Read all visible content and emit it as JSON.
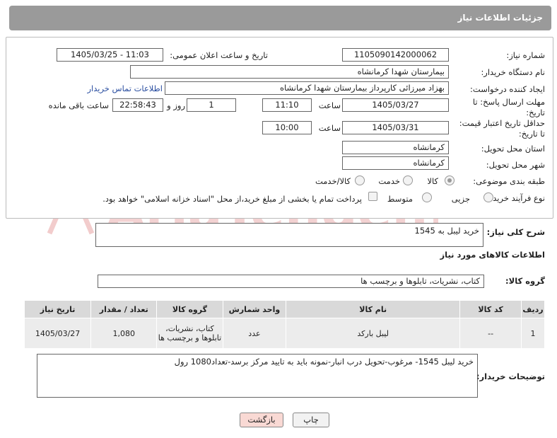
{
  "header": {
    "title": "جزئیات اطلاعات نیاز"
  },
  "form": {
    "need_number_label": "شماره نیاز:",
    "need_number": "1105090142000062",
    "announce_label": "تاریخ و ساعت اعلان عمومی:",
    "announce_value": "1405/03/25 - 11:03",
    "buyer_org_label": "نام دستگاه خریدار:",
    "buyer_org": "بیمارستان شهدا کرمانشاه",
    "requester_label": "ایجاد کننده درخواست:",
    "requester": "بهزاد میرزائی کارپرداز بیمارستان شهدا کرمانشاه",
    "contact_link": "اطلاعات تماس خریدار",
    "reply_deadline_label_1": "مهلت ارسال پاسخ: تا",
    "reply_deadline_label_2": "تاریخ:",
    "reply_date": "1405/03/27",
    "time_label": "ساعت",
    "reply_time": "11:10",
    "days_value": "1",
    "days_label": "روز و",
    "remaining_value": "22:58:43",
    "remaining_label": "ساعت باقی مانده",
    "price_deadline_label_1": "حداقل تاریخ اعتبار قیمت:",
    "price_deadline_label_2": "تا تاریخ:",
    "price_date": "1405/03/31",
    "price_time": "10:00",
    "province_label": "استان محل تحویل:",
    "province": "کرمانشاه",
    "city_label": "شهر محل تحویل:",
    "city": "کرمانشاه",
    "category_label": "طبقه بندی موضوعی:",
    "category_options": [
      "کالا",
      "خدمت",
      "کالا/خدمت"
    ],
    "process_label": "نوع فرآیند خرید :",
    "process_options": [
      "جزیی",
      "متوسط"
    ],
    "payment_note": "پرداخت تمام یا بخشی از مبلغ خرید،از محل \"اسناد خزانه اسلامی\" خواهد بود."
  },
  "summary": {
    "label": "شرح کلی نیاز:",
    "value": "خرید لیبل به 1545"
  },
  "goods_section": {
    "title": "اطلاعات کالاهای مورد نیاز"
  },
  "goods_group": {
    "label": "گروه کالا:",
    "value": "کتاب، نشریات، تابلوها و برچسب ها"
  },
  "table": {
    "headers": [
      "ردیف",
      "کد کالا",
      "نام کالا",
      "واحد شمارش",
      "گروه کالا",
      "تعداد / مقدار",
      "تاریخ نیاز"
    ],
    "rows": [
      {
        "row": "1",
        "code": "--",
        "name": "لیبل بارکد",
        "unit": "عدد",
        "group": "کتاب، نشریات، تابلوها و برچسب ها",
        "qty": "1,080",
        "date": "1405/03/27"
      }
    ]
  },
  "buyer_notes": {
    "label": "توضیحات خریدار:",
    "value": "خرید لیبل  1545- مرغوب-تحویل درب انبار-نمونه باید به تایید مرکز برسد-تعداد1080 رول"
  },
  "buttons": {
    "print": "چاپ",
    "back": "بازگشت"
  },
  "watermark": {
    "text": "AriaTender.neT"
  },
  "colors": {
    "header_bg": "#9a9a9a",
    "link": "#2a4ea0",
    "back_button": "#f9d9d4",
    "watermark": "#f0c4c4"
  }
}
